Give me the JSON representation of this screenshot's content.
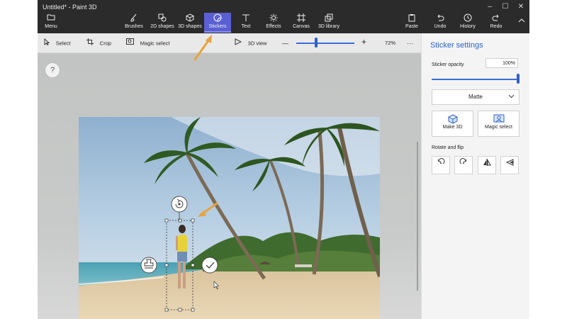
{
  "window": {
    "title": "Untitled* - Paint 3D",
    "controls": [
      "–",
      "☐",
      "✕"
    ]
  },
  "ribbon": {
    "menu": {
      "label": "Menu",
      "icon": "folder-icon"
    },
    "tools": [
      {
        "label": "Brushes",
        "icon": "brush-icon"
      },
      {
        "label": "2D shapes",
        "icon": "2d-shapes-icon"
      },
      {
        "label": "3D shapes",
        "icon": "3d-shapes-icon"
      },
      {
        "label": "Stickers",
        "icon": "sticker-icon",
        "active": true
      },
      {
        "label": "Text",
        "icon": "text-icon"
      },
      {
        "label": "Effects",
        "icon": "effects-icon"
      },
      {
        "label": "Canvas",
        "icon": "canvas-icon"
      },
      {
        "label": "3D library",
        "icon": "3d-library-icon"
      }
    ],
    "actions": [
      {
        "label": "Paste",
        "icon": "paste-icon"
      },
      {
        "label": "Undo",
        "icon": "undo-icon"
      },
      {
        "label": "History",
        "icon": "history-icon"
      },
      {
        "label": "Redo",
        "icon": "redo-icon"
      }
    ]
  },
  "toolbar": {
    "select": "Select",
    "crop": "Crop",
    "magic_select": "Magic select",
    "view_3d": "3D view",
    "zoom_minus": "—",
    "zoom_plus": "+",
    "zoom_level": "72%",
    "more": "···",
    "zoom_fraction": 0.36
  },
  "help": {
    "label": "?"
  },
  "panel": {
    "title": "Sticker settings",
    "opacity_label": "Sticker opacity",
    "opacity_value": "100%",
    "finish_value": "Matte",
    "make3d": "Make 3D",
    "magic_select": "Magic select",
    "rotate_flip_label": "Rotate and flip",
    "rotate_buttons": [
      "rotate-left-icon",
      "rotate-right-icon",
      "flip-horizontal-icon",
      "flip-vertical-icon"
    ]
  },
  "colors": {
    "ribbon_bg": "#2b2b2b",
    "accent": "#5a5fd3",
    "panel_title": "#2a62c9",
    "annotation_arrow": "#e8a33a"
  }
}
